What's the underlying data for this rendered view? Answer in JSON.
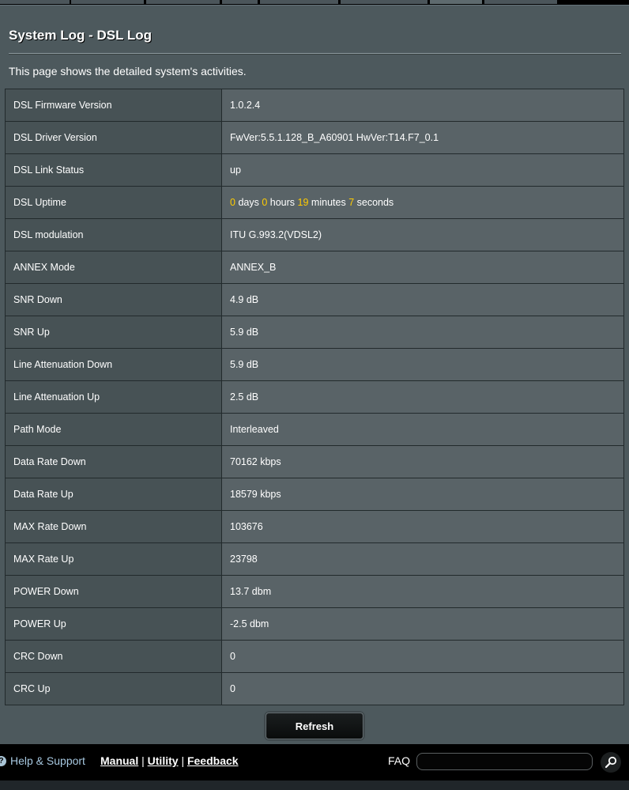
{
  "page": {
    "title": "System Log - DSL Log",
    "description": "This page shows the detailed system's activities."
  },
  "rows": [
    {
      "label": "DSL Firmware Version",
      "value": "1.0.2.4"
    },
    {
      "label": "DSL Driver Version",
      "value": "FwVer:5.5.1.128_B_A60901 HwVer:T14.F7_0.1"
    },
    {
      "label": "DSL Link Status",
      "value": "up"
    },
    {
      "label": "DSL Uptime",
      "uptime": {
        "days": "0",
        "days_label": "days",
        "hours": "0",
        "hours_label": "hours",
        "minutes": "19",
        "minutes_label": "minutes",
        "seconds": "7",
        "seconds_label": "seconds"
      }
    },
    {
      "label": "DSL modulation",
      "value": "ITU G.993.2(VDSL2)"
    },
    {
      "label": "ANNEX Mode",
      "value": "ANNEX_B"
    },
    {
      "label": "SNR Down",
      "value": "4.9 dB"
    },
    {
      "label": "SNR Up",
      "value": "5.9 dB"
    },
    {
      "label": "Line Attenuation Down",
      "value": "5.9 dB"
    },
    {
      "label": "Line Attenuation Up",
      "value": "2.5 dB"
    },
    {
      "label": "Path Mode",
      "value": "Interleaved"
    },
    {
      "label": "Data Rate Down",
      "value": "70162 kbps"
    },
    {
      "label": "Data Rate Up",
      "value": "18579 kbps"
    },
    {
      "label": "MAX Rate Down",
      "value": "103676"
    },
    {
      "label": "MAX Rate Up",
      "value": "23798"
    },
    {
      "label": "POWER Down",
      "value": "13.7 dbm"
    },
    {
      "label": "POWER Up",
      "value": "-2.5 dbm"
    },
    {
      "label": "CRC Down",
      "value": "0"
    },
    {
      "label": "CRC Up",
      "value": "0"
    }
  ],
  "buttons": {
    "refresh": "Refresh"
  },
  "footer": {
    "help_support": "Help & Support",
    "manual": "Manual",
    "utility": "Utility",
    "feedback": "Feedback",
    "separator": "|",
    "faq": "FAQ",
    "search_value": "",
    "help_icon": "question-icon",
    "search_icon": "magnifier-icon"
  },
  "colors": {
    "accent_number": "#ffcc00",
    "help_link": "#a7c8e0",
    "panel": "#4d595d"
  }
}
